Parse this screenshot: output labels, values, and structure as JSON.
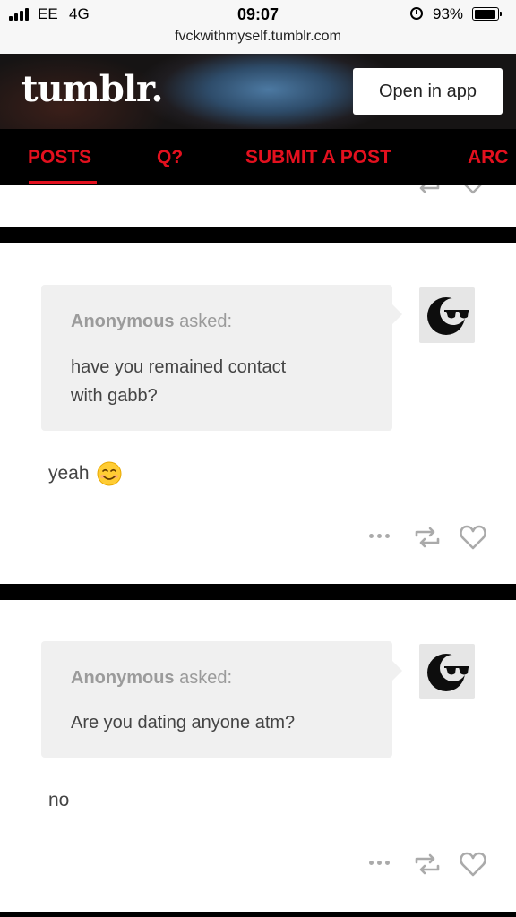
{
  "status_bar": {
    "carrier": "EE",
    "network": "4G",
    "time": "09:07",
    "battery": "93%",
    "battery_level": 0.93,
    "url": "fvckwithmyself.tumblr.com"
  },
  "header": {
    "logo": "tumblr.",
    "open_app_label": "Open in app"
  },
  "nav": {
    "items": [
      "POSTS",
      "Q?",
      "SUBMIT A POST",
      "ARC"
    ],
    "active": "POSTS",
    "accent_color": "#e3101e"
  },
  "posts": [
    {
      "asker": "Anonymous",
      "asked_label": "asked:",
      "question_lines": [
        "have you remained contact",
        "with gabb?"
      ],
      "answer": "yeah",
      "answer_emoji": "😊"
    },
    {
      "asker": "Anonymous",
      "asked_label": "asked:",
      "question_lines": [
        "Are you dating anyone atm?"
      ],
      "answer": "no"
    }
  ],
  "icons": [
    "signal-icon",
    "alarm-icon",
    "battery-icon",
    "avatar-sunglasses-icon",
    "more-icon",
    "reblog-icon",
    "like-icon"
  ]
}
